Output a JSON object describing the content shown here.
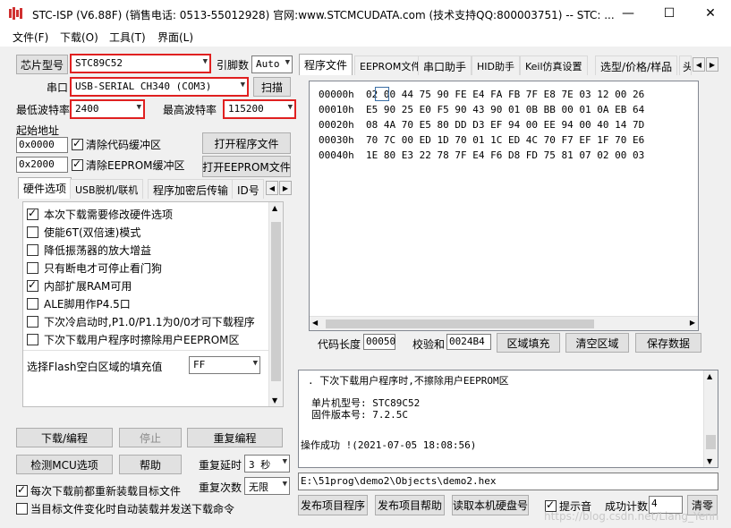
{
  "window": {
    "title": "STC-ISP (V6.88F) (销售电话: 0513-55012928) 官网:www.STCMCUDATA.com  (技术支持QQ:800003751) -- STC: ...",
    "min": "—",
    "max": "☐",
    "close": "✕"
  },
  "menu": [
    "文件(F)",
    "下载(O)",
    "工具(T)",
    "界面(L)"
  ],
  "chip": {
    "label": "芯片型号",
    "value": "STC89C52",
    "pin_label": "引脚数",
    "pin_value": "Auto"
  },
  "port": {
    "label": "串口",
    "value": "USB-SERIAL CH340 (COM3)",
    "scan": "扫描"
  },
  "baud": {
    "min_label": "最低波特率",
    "min_value": "2400",
    "max_label": "最高波特率",
    "max_value": "115200"
  },
  "start": {
    "label": "起始地址",
    "addr1": "0x0000",
    "addr2": "0x2000",
    "clear_code": "清除代码缓冲区",
    "clear_eeprom": "清除EEPROM缓冲区",
    "open_prog": "打开程序文件",
    "open_eeprom": "打开EEPROM文件"
  },
  "left_tabs": [
    "硬件选项",
    "USB脱机/联机",
    "程序加密后传输",
    "ID号"
  ],
  "options": [
    {
      "label": "本次下载需要修改硬件选项",
      "checked": true
    },
    {
      "label": "使能6T(双倍速)模式",
      "checked": false
    },
    {
      "label": "降低振荡器的放大增益",
      "checked": false
    },
    {
      "label": "只有断电才可停止看门狗",
      "checked": false
    },
    {
      "label": "内部扩展RAM可用",
      "checked": true
    },
    {
      "label": "ALE脚用作P4.5口",
      "checked": false
    },
    {
      "label": "下次冷启动时,P1.0/P1.1为0/0才可下载程序",
      "checked": false
    },
    {
      "label": "下次下载用户程序时擦除用户EEPROM区",
      "checked": false
    }
  ],
  "flash_fill": {
    "label": "选择Flash空白区域的填充值",
    "value": "FF"
  },
  "actions": {
    "download": "下载/编程",
    "stop": "停止",
    "repeat": "重复编程",
    "detect": "检测MCU选项",
    "help": "帮助",
    "delay_label": "重复延时",
    "delay_value": "3 秒",
    "count_label": "重复次数",
    "count_value": "无限"
  },
  "bottom_checks": [
    {
      "label": "每次下载前都重新装载目标文件",
      "checked": true
    },
    {
      "label": "当目标文件变化时自动装载并发送下载命令",
      "checked": false
    }
  ],
  "right_tabs": [
    "程序文件",
    "EEPROM文件",
    "串口助手",
    "HID助手",
    "Keil仿真设置",
    "选型/价格/样品",
    "头"
  ],
  "hex": [
    {
      "addr": "00000h",
      "bytes": "02 00 44 75 90 FE E4 FA FB 7F E8 7E 03 12 00 26"
    },
    {
      "addr": "00010h",
      "bytes": "E5 90 25 E0 F5 90 43 90 01 0B BB 00 01 0A EB 64"
    },
    {
      "addr": "00020h",
      "bytes": "08 4A 70 E5 80 DD D3 EF 94 00 EE 94 00 40 14 7D"
    },
    {
      "addr": "00030h",
      "bytes": "70 7C 00 ED 1D 70 01 1C ED 4C 70 F7 EF 1F 70 E6"
    },
    {
      "addr": "00040h",
      "bytes": "1E 80 E3 22 78 7F E4 F6 D8 FD 75 81 07 02 00 03"
    }
  ],
  "code_info": {
    "len_label": "代码长度",
    "len_value": "00050",
    "sum_label": "校验和",
    "sum_value": "0024B4",
    "fill": "区域填充",
    "clear": "清空区域",
    "save": "保存数据"
  },
  "log": [
    "下次下载用户程序时,不擦除用户EEPROM区",
    "单片机型号: STC89C52",
    "固件版本号: 7.2.5C",
    "操作成功 !(2021-07-05 18:08:56)"
  ],
  "filepath": "E:\\51prog\\demo2\\Objects\\demo2.hex",
  "footer": {
    "publish": "发布项目程序",
    "publish_help": "发布项目帮助",
    "read_hdd": "读取本机硬盘号",
    "beep": "提示音",
    "success_label": "成功计数",
    "success_value": "4",
    "clear": "清零"
  },
  "watermark": "https://blog.csdn.net/Liang_Yenn",
  "colors": {
    "highlight_red": "#e02020",
    "title_icon_red": "#d03030"
  }
}
